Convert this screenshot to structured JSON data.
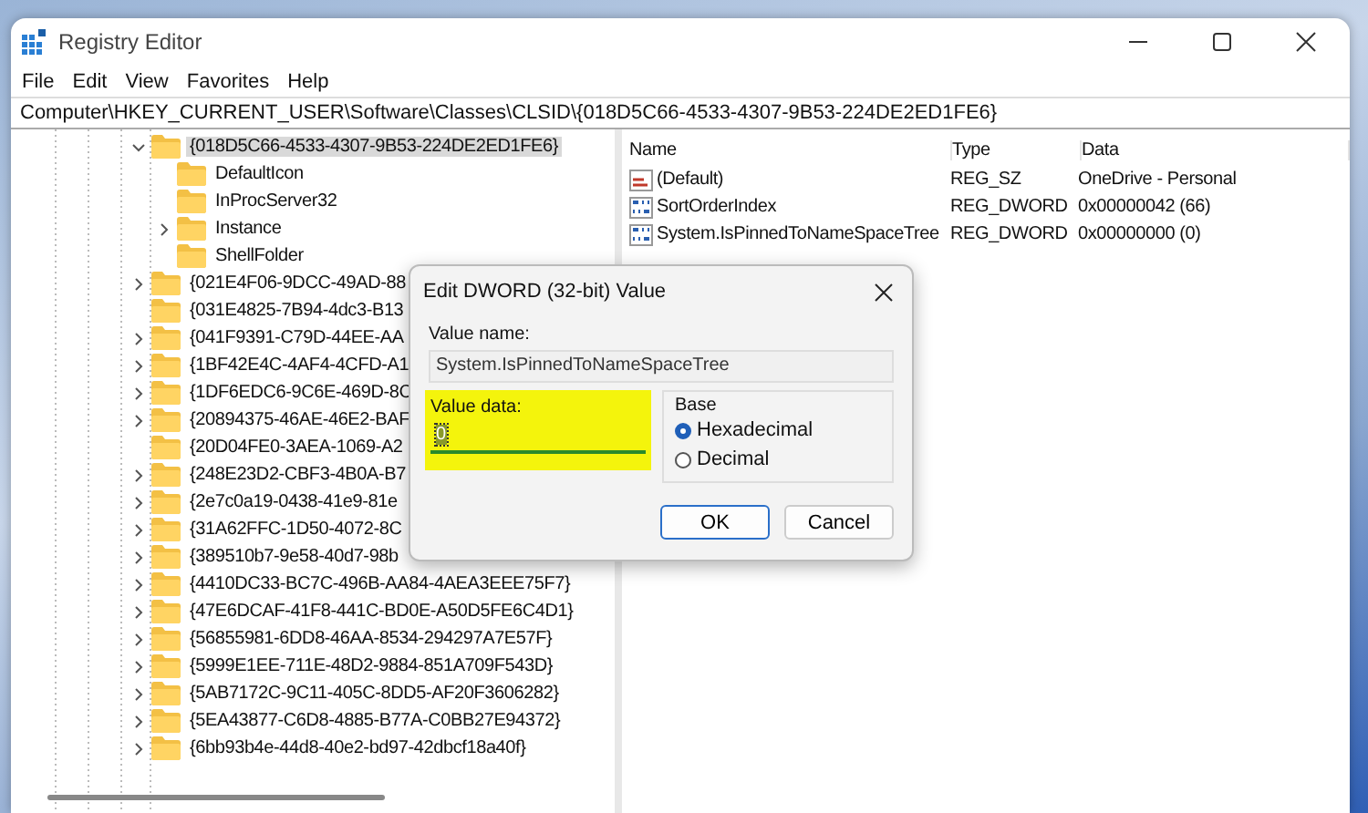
{
  "window": {
    "title": "Registry Editor"
  },
  "menu": [
    "File",
    "Edit",
    "View",
    "Favorites",
    "Help"
  ],
  "address": "Computer\\HKEY_CURRENT_USER\\Software\\Classes\\CLSID\\{018D5C66-4533-4307-9B53-224DE2ED1FE6}",
  "tree": [
    {
      "label": "{018D5C66-4533-4307-9B53-224DE2ED1FE6}",
      "selected": true,
      "expanded": true,
      "has_children": true,
      "children": [
        {
          "label": "DefaultIcon",
          "selected": false,
          "has_children": false
        },
        {
          "label": "InProcServer32",
          "selected": false,
          "has_children": false
        },
        {
          "label": "Instance",
          "selected": false,
          "expanded": false,
          "has_children": true
        },
        {
          "label": "ShellFolder",
          "selected": false,
          "has_children": false
        }
      ]
    },
    {
      "label": "{021E4F06-9DCC-49AD-88",
      "selected": false,
      "expanded": false,
      "has_children": true
    },
    {
      "label": "{031E4825-7B94-4dc3-B13",
      "selected": false,
      "has_children": false
    },
    {
      "label": "{041F9391-C79D-44EE-AA",
      "selected": false,
      "expanded": false,
      "has_children": true
    },
    {
      "label": "{1BF42E4C-4AF4-4CFD-A1",
      "selected": false,
      "expanded": false,
      "has_children": true
    },
    {
      "label": "{1DF6EDC6-9C6E-469D-8C",
      "selected": false,
      "expanded": false,
      "has_children": true
    },
    {
      "label": "{20894375-46AE-46E2-BAF",
      "selected": false,
      "expanded": false,
      "has_children": true
    },
    {
      "label": "{20D04FE0-3AEA-1069-A2",
      "selected": false,
      "has_children": false
    },
    {
      "label": "{248E23D2-CBF3-4B0A-B7",
      "selected": false,
      "expanded": false,
      "has_children": true
    },
    {
      "label": "{2e7c0a19-0438-41e9-81e",
      "selected": false,
      "expanded": false,
      "has_children": true
    },
    {
      "label": "{31A62FFC-1D50-4072-8C",
      "selected": false,
      "expanded": false,
      "has_children": true
    },
    {
      "label": "{389510b7-9e58-40d7-98b",
      "selected": false,
      "expanded": false,
      "has_children": true
    },
    {
      "label": "{4410DC33-BC7C-496B-AA84-4AEA3EEE75F7}",
      "selected": false,
      "expanded": false,
      "has_children": true
    },
    {
      "label": "{47E6DCAF-41F8-441C-BD0E-A50D5FE6C4D1}",
      "selected": false,
      "expanded": false,
      "has_children": true
    },
    {
      "label": "{56855981-6DD8-46AA-8534-294297A7E57F}",
      "selected": false,
      "expanded": false,
      "has_children": true
    },
    {
      "label": "{5999E1EE-711E-48D2-9884-851A709F543D}",
      "selected": false,
      "expanded": false,
      "has_children": true
    },
    {
      "label": "{5AB7172C-9C11-405C-8DD5-AF20F3606282}",
      "selected": false,
      "expanded": false,
      "has_children": true
    },
    {
      "label": "{5EA43877-C6D8-4885-B77A-C0BB27E94372}",
      "selected": false,
      "expanded": false,
      "has_children": true
    },
    {
      "label": "{6bb93b4e-44d8-40e2-bd97-42dbcf18a40f}",
      "selected": false,
      "expanded": false,
      "has_children": true
    }
  ],
  "values": {
    "columns": [
      "Name",
      "Type",
      "Data"
    ],
    "rows": [
      {
        "kind": "string",
        "name": "(Default)",
        "type": "REG_SZ",
        "data": "OneDrive - Personal"
      },
      {
        "kind": "binary",
        "name": "SortOrderIndex",
        "type": "REG_DWORD",
        "data": "0x00000042 (66)"
      },
      {
        "kind": "binary",
        "name": "System.IsPinnedToNameSpaceTree",
        "type": "REG_DWORD",
        "data": "0x00000000 (0)"
      }
    ]
  },
  "dialog": {
    "title": "Edit DWORD (32-bit) Value",
    "value_name_label": "Value name:",
    "value_name": "System.IsPinnedToNameSpaceTree",
    "value_data_label": "Value data:",
    "value_data": "0",
    "base_label": "Base",
    "base_options": [
      {
        "label": "Hexadecimal",
        "selected": true
      },
      {
        "label": "Decimal",
        "selected": false
      }
    ],
    "buttons": [
      {
        "label": "OK",
        "kind": "default"
      },
      {
        "label": "Cancel",
        "kind": "normal"
      }
    ]
  }
}
